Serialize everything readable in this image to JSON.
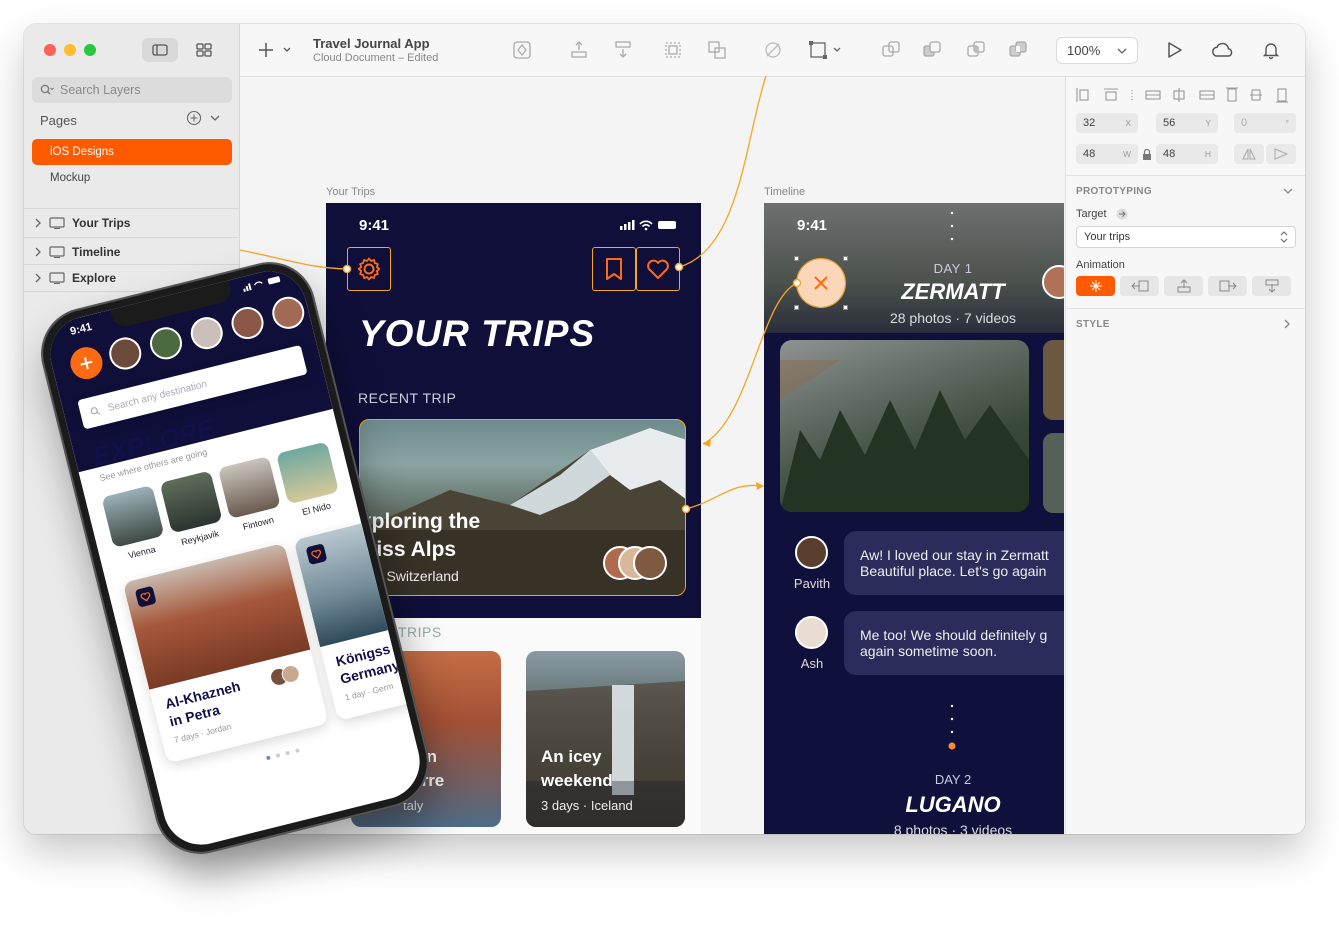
{
  "window": {
    "title": "Travel Journal App",
    "subtitle": "Cloud Document – Edited"
  },
  "sidebar": {
    "search_placeholder": "Search Layers",
    "pages_label": "Pages",
    "pages": [
      {
        "label": "iOS Designs",
        "selected": true
      },
      {
        "label": "Mockup",
        "selected": false
      }
    ],
    "layers": [
      {
        "label": "Your Trips"
      },
      {
        "label": "Timeline"
      },
      {
        "label": "Explore"
      }
    ]
  },
  "toolbar": {
    "zoom": "100%"
  },
  "inspector": {
    "x": "32",
    "y": "56",
    "rot": "0",
    "w": "48",
    "h": "48",
    "x_u": "X",
    "y_u": "Y",
    "rot_u": "°",
    "w_u": "W",
    "h_u": "H",
    "prototyping": "PROTOTYPING",
    "target_label": "Target",
    "target_value": "Your trips",
    "animation_label": "Animation",
    "style": "STYLE"
  },
  "artboards": {
    "your_trips": {
      "label": "Your Trips",
      "time": "9:41",
      "title": "YOUR TRIPS",
      "recent": "RECENT TRIP",
      "card_title": "xploring the",
      "card_title2": "wiss Alps",
      "card_meta": "ys · Switzerland",
      "trips_label": "TRIPS",
      "mini1_title": "la in",
      "mini1_title2": "Terre",
      "mini1_meta": "taly",
      "mini2_title": "An icey",
      "mini2_title2": "weekend",
      "mini2_meta": "3 days · Iceland"
    },
    "timeline": {
      "label": "Timeline",
      "time": "9:41",
      "day1": "DAY 1",
      "place1": "ZERMATT",
      "meta1": "28 photos · 7 videos",
      "c1_name": "Pavith",
      "c1_text1": "Aw! I loved our stay in Zermatt",
      "c1_text2": "Beautiful place. Let's go again",
      "c2_name": "Ash",
      "c2_text1": "Me too! We should definitely g",
      "c2_text2": "again sometime soon.",
      "day2": "DAY 2",
      "place2": "LUGANO",
      "meta2": "8 photos · 3 videos"
    }
  },
  "phone": {
    "time": "9:41",
    "search_placeholder": "Search any destination",
    "title": "EXPLORE",
    "subtitle": "See where others are going",
    "places": [
      "Vienna",
      "Reykjavik",
      "Fintown",
      "El Nido"
    ],
    "card1_title": "Al-Khazneh",
    "card1_title2": "in Petra",
    "card1_meta": "7 days · Jordan",
    "card2_title": "Königss",
    "card2_title2": "Germany",
    "card2_meta": "1 day · Germ"
  },
  "colors": {
    "accent": "#ff6a13",
    "navy": "#0f0f3a",
    "proto": "#f5a623"
  }
}
